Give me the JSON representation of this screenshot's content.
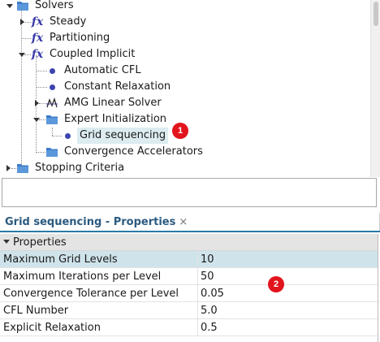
{
  "tree": {
    "items": [
      {
        "label": "Solvers",
        "icon": "folder-icon"
      },
      {
        "label": "Steady",
        "icon": "fx-icon"
      },
      {
        "label": "Partitioning",
        "icon": "fx-icon"
      },
      {
        "label": "Coupled Implicit",
        "icon": "fx-icon"
      },
      {
        "label": "Automatic CFL",
        "icon": "dot-icon"
      },
      {
        "label": "Constant Relaxation",
        "icon": "dot-icon"
      },
      {
        "label": "AMG Linear Solver",
        "icon": "solver-icon"
      },
      {
        "label": "Expert Initialization",
        "icon": "folder-icon"
      },
      {
        "label": "Grid sequencing",
        "icon": "dot-icon"
      },
      {
        "label": "Convergence Accelerators",
        "icon": "folder-icon"
      },
      {
        "label": "Stopping Criteria",
        "icon": "folder-icon"
      }
    ]
  },
  "callouts": {
    "one": "1",
    "two": "2"
  },
  "properties": {
    "tab_title": "Grid sequencing - Properties",
    "close_glyph": "×",
    "group_label": "Properties",
    "rows": [
      {
        "name": "Maximum Grid Levels",
        "value": "10"
      },
      {
        "name": "Maximum Iterations per Level",
        "value": "50"
      },
      {
        "name": "Convergence Tolerance per Level",
        "value": "0.05"
      },
      {
        "name": "CFL Number",
        "value": "5.0"
      },
      {
        "name": "Explicit Relaxation",
        "value": "0.5"
      }
    ]
  },
  "colors": {
    "folder": "#3d7cc9",
    "fx": "#3a3aa8",
    "dot": "#3c44b0",
    "selection": "#dcecf0",
    "callout": "#e2141c",
    "tab_accent": "#2b7aa6"
  }
}
